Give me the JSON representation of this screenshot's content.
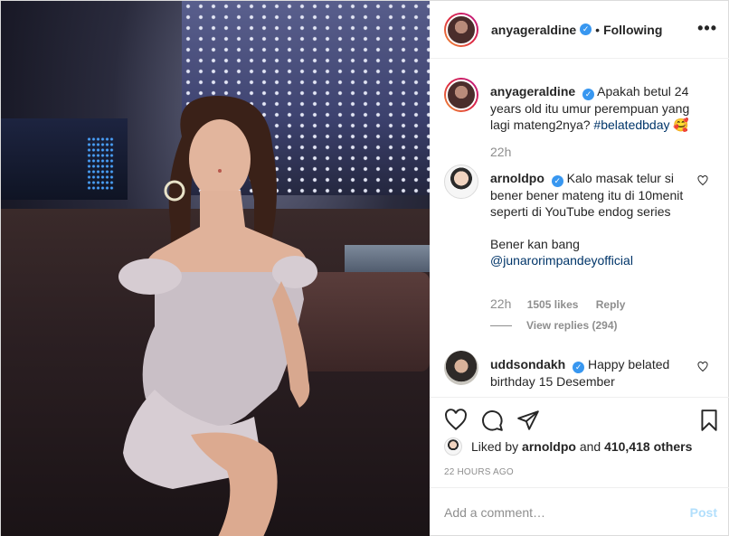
{
  "post": {
    "author": "anyageraldine",
    "verified_icon": "verified-badge-icon",
    "separator": "•",
    "follow_status": "Following",
    "more_glyph": "•••"
  },
  "caption": {
    "username": "anyageraldine",
    "text": "Apakah betul 24 years old itu umur perempuan yang lagi mateng2nya?",
    "hashtag": "#belatedbday",
    "emoji": "🥰",
    "time": "22h"
  },
  "comments": [
    {
      "username": "arnoldpo",
      "text_line1": "Kalo masak telur si bener bener mateng itu di 10menit seperti di YouTube endog series",
      "text_line2": "Bener kan bang",
      "mention": "@junarorimpandeyofficial",
      "time": "22h",
      "likes": "1505 likes",
      "reply": "Reply",
      "view_replies": "View replies (294)"
    },
    {
      "username": "uddsondakh",
      "text": "Happy belated birthday 15 Desember"
    }
  ],
  "likes": {
    "prefix": "Liked by",
    "user": "arnoldpo",
    "and": "and",
    "count": "410,418 others"
  },
  "posted_time": "22 HOURS AGO",
  "composer": {
    "placeholder": "Add a comment…",
    "post_label": "Post"
  },
  "colors": {
    "link": "#003569",
    "verified": "#3897f0",
    "muted": "#8e8e8e",
    "post_disabled": "#b2dffc"
  }
}
